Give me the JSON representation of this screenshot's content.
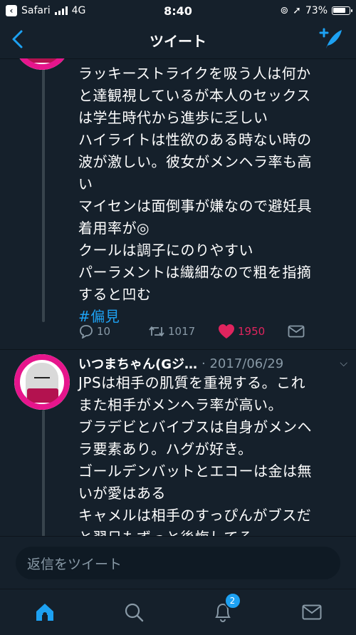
{
  "status_bar": {
    "carrier": "Safari",
    "network": "4G",
    "time": "8:40",
    "battery": "73%"
  },
  "nav": {
    "title": "ツイート"
  },
  "tweet1": {
    "lines": [
      "ラッキーストライクを吸う人は何か",
      "と達観視しているが本人のセックス",
      "は学生時代から進歩に乏しい",
      "ハイライトは性欲のある時ない時の",
      "波が激しい。彼女がメンヘラ率も高",
      "い",
      "マイセンは面倒事が嫌なので避妊具",
      "着用率が◎",
      "クールは調子にのりやすい",
      "パーラメントは繊細なので粗を指摘",
      "すると凹む"
    ],
    "hashtag": "#偏見",
    "replies": "10",
    "retweets": "1017",
    "likes": "1950"
  },
  "tweet2": {
    "author": "いつまちゃん(Gジ…",
    "date": "· 2017/06/29",
    "lines": [
      "JPSは相手の肌質を重視する。これ",
      "また相手がメンヘラ率が高い。",
      "ブラデビとバイブスは自身がメンヘ",
      "ラ要素あり。ハグが好き。",
      "ゴールデンバットとエコーは金は無",
      "いが愛はある",
      "キャメルは相手のすっぴんがブスだ",
      "と翌日もずっと後悔してる"
    ]
  },
  "reply_box": {
    "placeholder": "返信をツイート"
  },
  "tabbar": {
    "notifications_badge": "2"
  },
  "colors": {
    "background": "#15202b",
    "accent": "#1da1f2",
    "like": "#e0245e",
    "muted": "#8899a6"
  }
}
